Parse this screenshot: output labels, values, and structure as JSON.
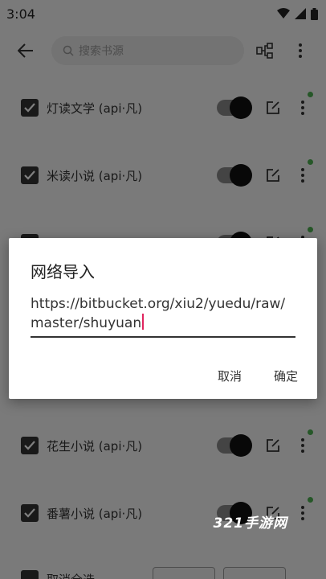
{
  "status_bar": {
    "time": "3:04",
    "icons": [
      "wifi-icon",
      "signal-icon",
      "battery-icon"
    ]
  },
  "toolbar": {
    "back_icon": "arrow-left-icon",
    "search_placeholder": "搜索书源",
    "group_icon": "group-icon",
    "more_icon": "more-vertical-icon"
  },
  "sources": [
    {
      "label": "灯读文学 (api·凡)",
      "checked": true,
      "enabled": true
    },
    {
      "label": "米读小说 (api·凡)",
      "checked": true,
      "enabled": true
    },
    {
      "label": "",
      "checked": true,
      "enabled": true
    },
    {
      "label": "",
      "checked": false,
      "enabled": false
    },
    {
      "label": "",
      "checked": false,
      "enabled": false
    },
    {
      "label": "花生小说 (api·凡)",
      "checked": true,
      "enabled": true
    },
    {
      "label": "番薯小说 (api·凡)",
      "checked": true,
      "enabled": true
    }
  ],
  "bottom_bar": {
    "select_all_label": "取消全选"
  },
  "dialog": {
    "title": "网络导入",
    "input_value": "https://bitbucket.org/xiu2/yuedu/raw/master/shuyuan",
    "cancel_label": "取消",
    "confirm_label": "确定"
  },
  "colors": {
    "accent_caret": "#e0245e",
    "status_dot": "#4caf50"
  },
  "watermark": "321手游网"
}
